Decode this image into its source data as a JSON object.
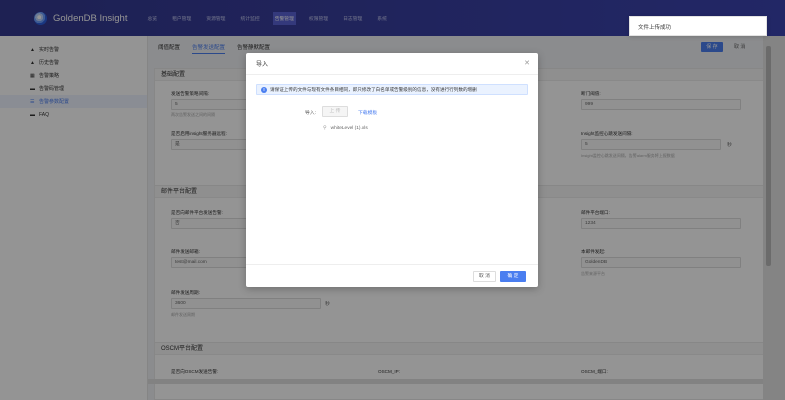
{
  "app": {
    "title": "GoldenDB Insight"
  },
  "nav": {
    "items": [
      "总览",
      "租户管理",
      "资源管理",
      "统计监控",
      "告警管理",
      "权限管理",
      "日志管理",
      "系统"
    ],
    "active_index": 4
  },
  "sidebar": {
    "items": [
      {
        "label": "实时告警",
        "icon": "alarm-bell-icon"
      },
      {
        "label": "历史告警",
        "icon": "history-icon"
      },
      {
        "label": "告警策略",
        "icon": "strategy-icon"
      },
      {
        "label": "告警码管理",
        "icon": "code-icon"
      },
      {
        "label": "告警参数配置",
        "icon": "settings-icon"
      },
      {
        "label": "FAQ",
        "icon": "faq-icon"
      }
    ],
    "active_index": 4
  },
  "tabs": [
    "阈值配置",
    "告警发送配置",
    "告警静默配置"
  ],
  "tabs_active_index": 1,
  "toolbar": {
    "save": "保 存",
    "cancel": "取 消"
  },
  "basic": {
    "title": "基础配置",
    "f1_label": "发送告警策略间隔:",
    "f1_value": "5",
    "f1_hint": "两次告警发送之间的间隔",
    "f2_label": "是否启用insight服务器远程:",
    "f2_value": "是",
    "r1_label": "断门阈值:",
    "r1_value": "999",
    "r2_label": "Insight监控心跳发送间隔:",
    "r2_value": "5",
    "r2_unit": "秒",
    "r2_hint": "Insight监控心跳发送间隔，告警alarm服务将上报数据"
  },
  "mail": {
    "title": "邮件平台配置",
    "f1_label": "是否向邮件平台发送告警:",
    "f1_value": "否",
    "f2_label": "邮件发送邮箱:",
    "f2_value": "test@mail.com",
    "f3_label": "邮件发送周期:",
    "f3_value": "3600",
    "f3_unit": "秒",
    "f3_hint": "邮件发送周期",
    "r1_label": "邮件平台端口:",
    "r1_value": "1234",
    "r2_label": "本邮件发起:",
    "r2_value": "GoldenDB",
    "r2_hint": "告警来源平台"
  },
  "oscm": {
    "title": "OSCM平台配置",
    "f1_label": "是否向OSCM发送告警:",
    "f2_label": "OSCM_IP:",
    "f3_label": "OSCM_端口:"
  },
  "modal": {
    "title": "导入",
    "alert": "请保证上传的文件与现有文件条目相同，即只修改了白名单或告警级别的信息，没有进行行列数的增删",
    "import_label": "导入:",
    "upload": "上 传",
    "download": "下载模板",
    "file": "whiteLevel (1).xls",
    "cancel": "取 消",
    "ok": "确 定"
  },
  "toast": {
    "text": "文件上传成功"
  }
}
